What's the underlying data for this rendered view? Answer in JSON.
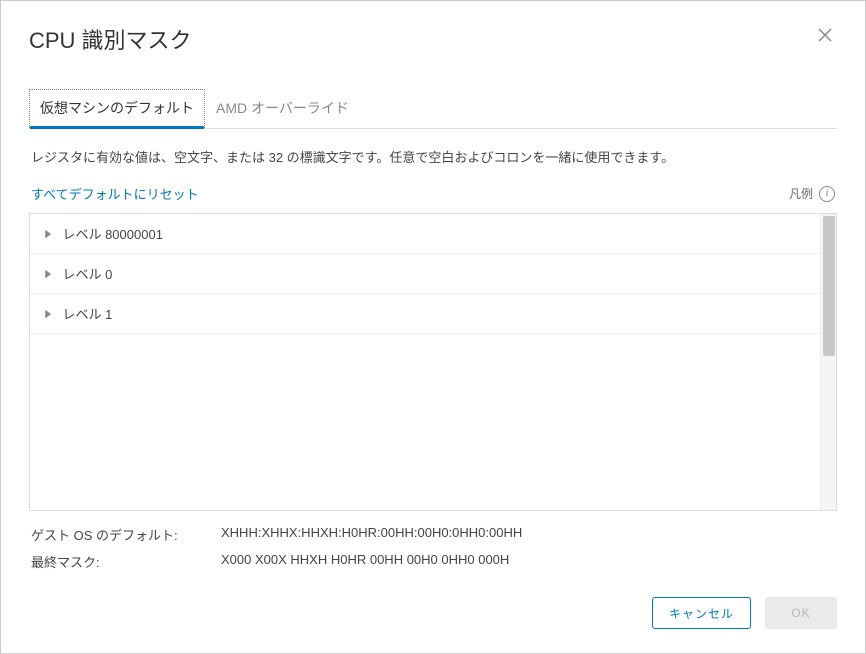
{
  "header": {
    "title": "CPU 識別マスク"
  },
  "tabs": {
    "items": [
      {
        "label": "仮想マシンのデフォルト",
        "active": true
      },
      {
        "label": "AMD オーバーライド",
        "active": false
      }
    ]
  },
  "hint": "レジスタに有効な値は、空文字、または 32 の標識文字です。任意で空白およびコロンを一緒に使用できます。",
  "reset_link": "すべてデフォルトにリセット",
  "legend_label": "凡例",
  "list": {
    "items": [
      {
        "label": "レベル 80000001"
      },
      {
        "label": "レベル 0"
      },
      {
        "label": "レベル 1"
      }
    ]
  },
  "footer_values": {
    "guest_default_label": "ゲスト OS のデフォルト:",
    "guest_default_value": "XHHH:XHHX:HHXH:H0HR:00HH:00H0:0HH0:00HH",
    "final_mask_label": "最終マスク:",
    "final_mask_value": "X000 X00X HHXH H0HR 00HH 00H0 0HH0 000H"
  },
  "buttons": {
    "cancel": "キャンセル",
    "ok": "OK"
  }
}
